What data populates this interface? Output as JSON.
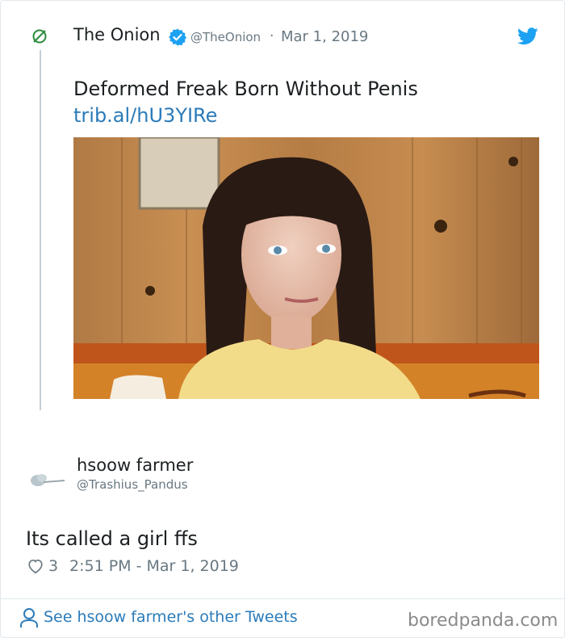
{
  "quoted_tweet": {
    "author_name": "The Onion",
    "author_handle": "@TheOnion",
    "separator": "·",
    "date": "Mar 1, 2019",
    "text": "Deformed Freak Born Without Penis",
    "link": "trib.al/hU3YIRe",
    "icons": {
      "logo": "onion-logo-icon",
      "verified": "verified-badge-icon",
      "platform": "twitter-bird-icon"
    },
    "colors": {
      "logo_green": "#2a8a3a",
      "verified_blue": "#1da1f2",
      "bird_blue": "#1da1f2",
      "link_blue": "#2b7bb9"
    }
  },
  "reply_tweet": {
    "author_name": "hsoow farmer",
    "author_handle": "@Trashius_Pandus",
    "text": "Its called a girl ffs",
    "like_count": "3",
    "time": "2:51 PM - Mar 1, 2019",
    "icons": {
      "like": "heart-icon"
    }
  },
  "footer": {
    "see_more": "See hsoow farmer's other Tweets",
    "watermark": "boredpanda.com",
    "icons": {
      "profile": "person-icon"
    }
  }
}
